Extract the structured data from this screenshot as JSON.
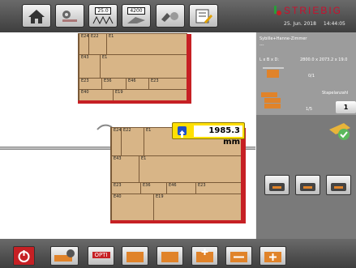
{
  "toolbar": {
    "btn2_value": "25.0",
    "btn3_value": "4200"
  },
  "brand": {
    "name": "STRIEBIG"
  },
  "datetime": {
    "date": "25. Jun. 2018",
    "time": "14:44:05"
  },
  "panel": {
    "title": "Sybille+Hanne-Zimmer",
    "sub": "---",
    "dims_label": "L x B x D:",
    "dims_value": "2800.0 x 2073.2 x 19.0",
    "pieces": "0/1",
    "stack_count_label": "Stapelanzahl",
    "stack_position": "1/5",
    "stack_count_value": "1"
  },
  "measure": {
    "value": "1985.3 mm"
  },
  "bottom": {
    "opti_label": "OPTI"
  },
  "top_stack": {
    "rows": [
      [
        "E24",
        "E22",
        "E1"
      ],
      [
        "E43",
        "E1"
      ],
      [
        "E23",
        "E36",
        "E46",
        "E23"
      ],
      [
        "E40",
        "E19"
      ]
    ]
  },
  "main_stack": {
    "rows": [
      [
        "E24",
        "E22",
        "E1"
      ],
      [
        "E43",
        "E1"
      ],
      [
        "E23",
        "E36",
        "E46",
        "E23"
      ],
      [
        "E40",
        "E19"
      ]
    ]
  },
  "colors": {
    "accent": "#c62024",
    "wood": "#d8b587",
    "highlight": "#ffe000"
  }
}
